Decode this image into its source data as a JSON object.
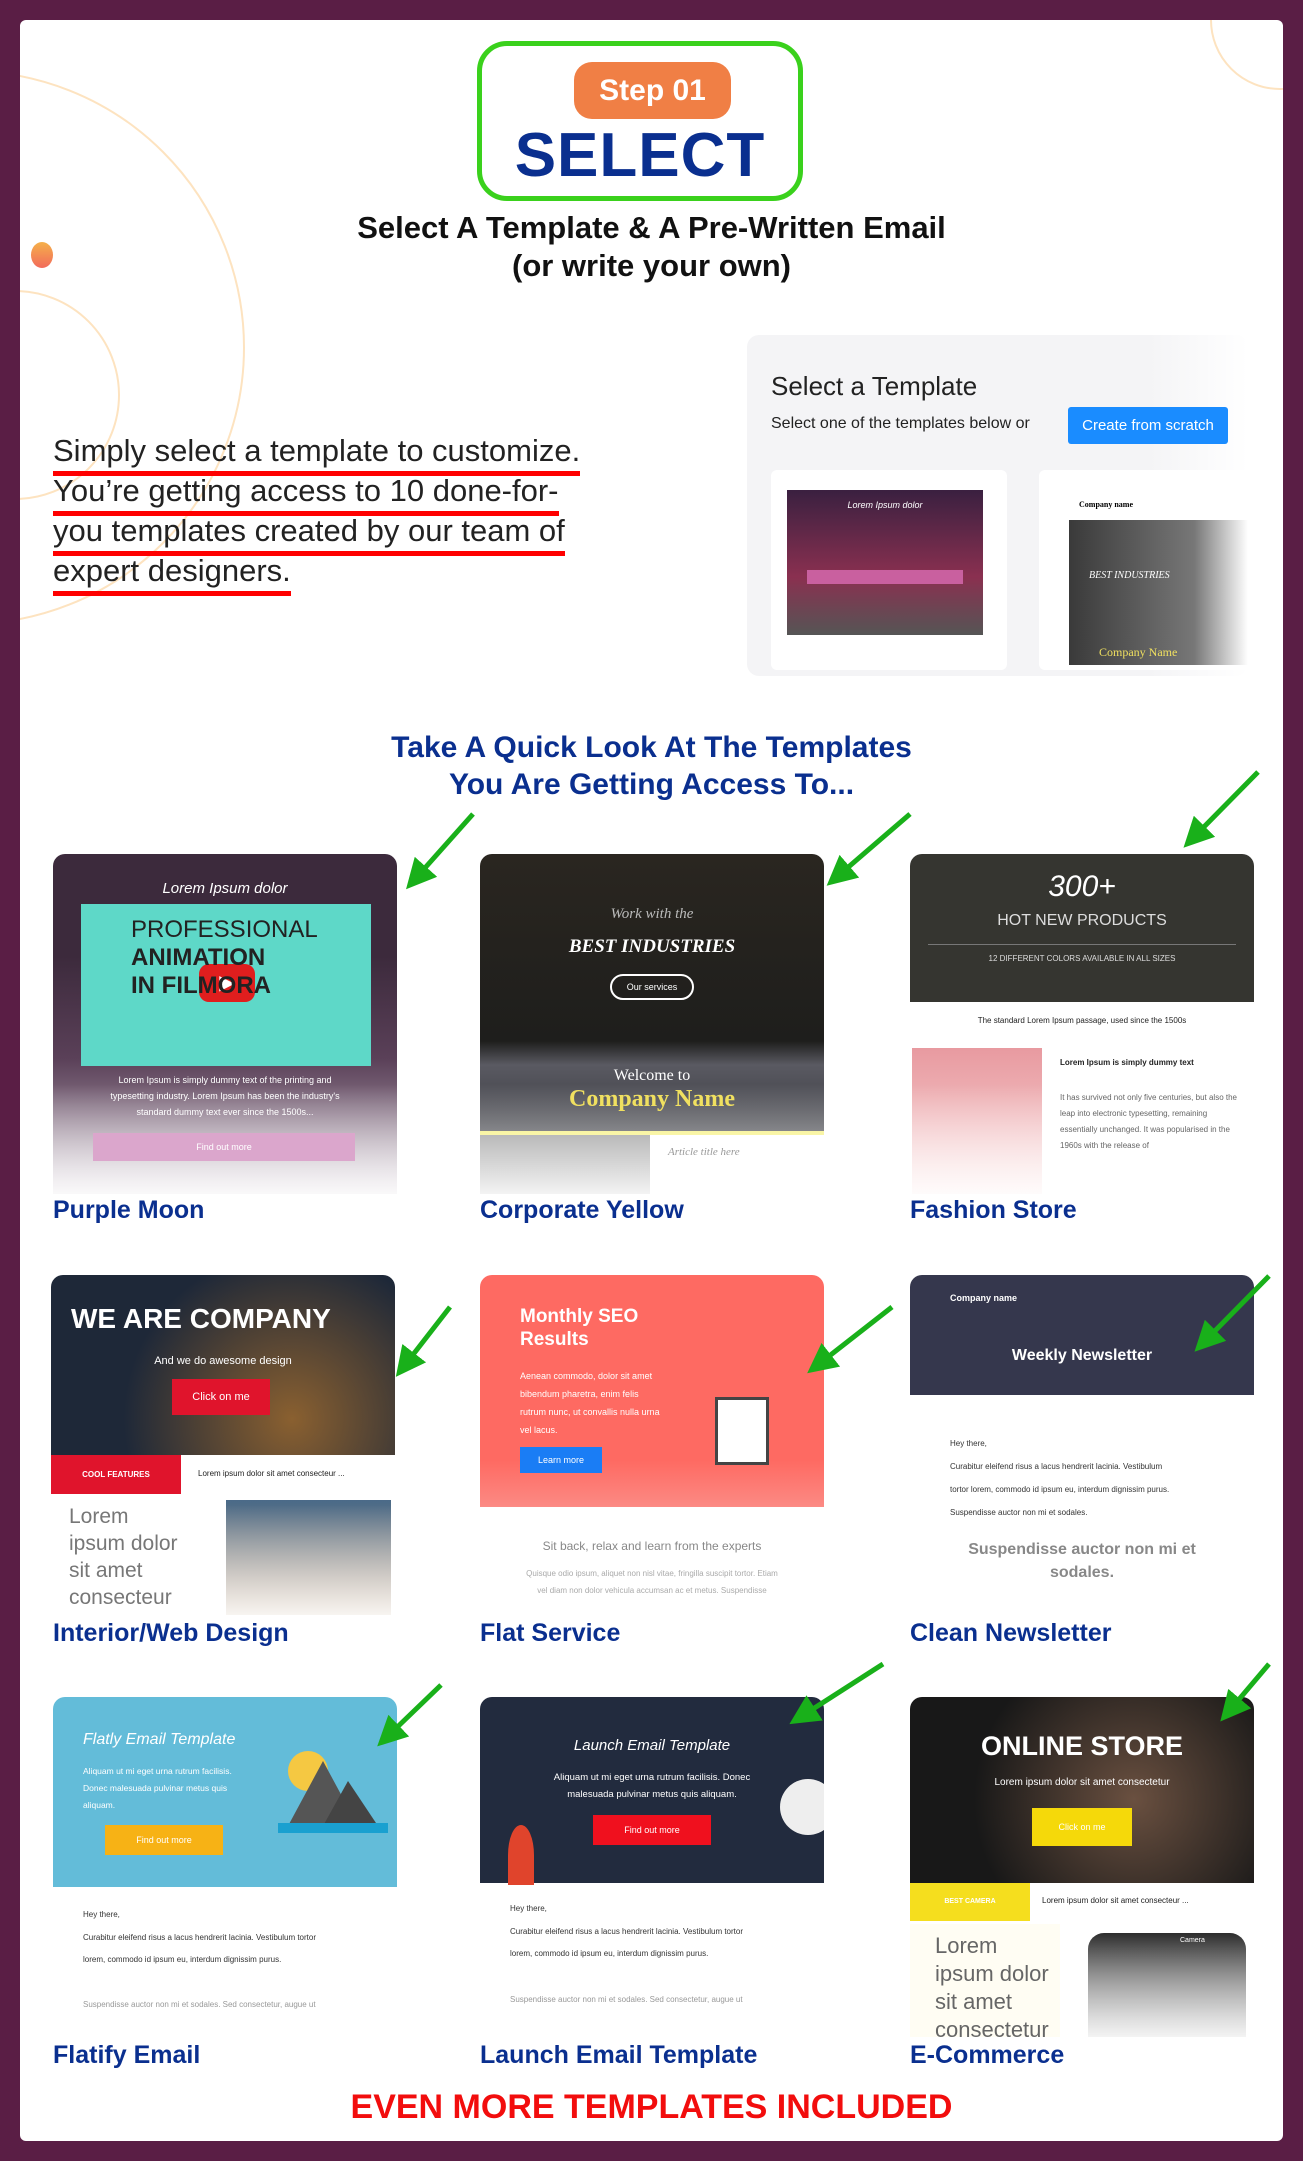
{
  "step": {
    "badge": "Step 01",
    "title": "SELECT"
  },
  "subtitle": {
    "line1": "Select A Template & A Pre-Written Email",
    "line2": "(or write your own)"
  },
  "intro": {
    "lines": [
      "Simply select a template to customize.",
      "You’re getting access to 10 done-for-",
      "you templates created by our team of",
      "expert designers."
    ]
  },
  "mockup": {
    "title": "Select a Template",
    "subtitle": "Select one of the templates below or",
    "button": "Create from scratch",
    "thumb1_title": "Lorem Ipsum dolor",
    "thumb2_title": "Company name",
    "thumb2_sub": "BEST INDUSTRIES",
    "thumb2_foot": "Company Name"
  },
  "section": {
    "line1": "Take A Quick Look At The Templates",
    "line2": "You Are Getting Access To..."
  },
  "colors": {
    "brand_blue": "#0a2f8f",
    "accent_red": "#f20d0d",
    "arrow_green": "#19b01a",
    "step_orange": "#f07f45",
    "frame_green": "#3ad11c",
    "border_purple": "#5a1e45"
  },
  "templates": [
    {
      "name": "Purple Moon",
      "heading": "Lorem Ipsum dolor",
      "video1": "PROFESSIONAL",
      "video2": "ANIMATION",
      "video3": "IN FILMORA",
      "body": "Lorem Ipsum is simply dummy text of the printing and typesetting industry. Lorem Ipsum has been the industry's standard dummy text ever since the 1500s...",
      "button": "Find out more"
    },
    {
      "name": "Corporate Yellow",
      "pre": "Work with the",
      "heading": "BEST INDUSTRIES",
      "button": "Our services",
      "welcome": "Welcome to",
      "company": "Company Name",
      "article": "Article title here"
    },
    {
      "name": "Fashion Store",
      "big": "300+",
      "heading": "HOT NEW PRODUCTS",
      "sub": "12 DIFFERENT COLORS AVAILABLE IN ALL SIZES",
      "passage": "The standard Lorem Ipsum passage, used since the 1500s",
      "item": "Lorem Ipsum is simply dummy text",
      "body": "It has survived not only five centuries, but also the leap into electronic typesetting, remaining essentially unchanged. It was popularised in the 1960s with the release of"
    },
    {
      "name": "Interior/Web Design",
      "heading": "WE ARE COMPANY",
      "sub": "And we do awesome design",
      "button": "Click on me",
      "tag": "COOL FEATURES",
      "tagtext": "Lorem ipsum dolor sit amet consecteur ...",
      "big": "Lorem ipsum dolor sit amet consecteur"
    },
    {
      "name": "Flat Service",
      "heading": "Monthly SEO Results",
      "body": "Aenean commodo, dolor sit amet bibendum pharetra, enim felis rutrum nunc, ut convallis nulla urna vel lacus.",
      "button": "Learn more",
      "tagline": "Sit back, relax and learn from the experts",
      "small": "Quisque odio ipsum, aliquet non nisl vitae, fringilla suscipit tortor. Etiam vel diam non dolor vehicula accumsan ac et metus. Suspendisse"
    },
    {
      "name": "Clean Newsletter",
      "company": "Company name",
      "heading": "Weekly Newsletter",
      "greet": "Hey there,",
      "body1": "Curabitur eleifend risus a lacus hendrerit lacinia. Vestibulum",
      "body2": "tortor lorem, commodo id ipsum eu, interdum dignissim purus.",
      "body3": "Suspendisse auctor non mi et sodales.",
      "quote": "Suspendisse auctor non mi et sodales."
    },
    {
      "name": "Flatify Email",
      "heading": "Flatly Email Template",
      "body": "Aliquam ut mi eget urna rutrum facilisis. Donec malesuada pulvinar metus quis aliquam.",
      "button": "Find out more",
      "greet": "Hey there,",
      "text1": "Curabitur eleifend risus a lacus hendrerit lacinia. Vestibulum tortor",
      "text2": "lorem, commodo id ipsum eu, interdum dignissim purus.",
      "text3": "Suspendisse auctor non mi et sodales. Sed consectetur, augue ut"
    },
    {
      "name": "Launch Email Template",
      "heading": "Launch Email Template",
      "body": "Aliquam ut mi eget urna rutrum facilisis. Donec malesuada pulvinar metus quis aliquam.",
      "button": "Find out more",
      "greet": "Hey there,",
      "text1": "Curabitur eleifend risus a lacus hendrerit lacinia. Vestibulum tortor",
      "text2": "lorem, commodo id ipsum eu, interdum dignissim purus.",
      "text3": "Suspendisse auctor non mi et sodales. Sed consectetur, augue ut"
    },
    {
      "name": "E-Commerce",
      "heading": "ONLINE STORE",
      "sub": "Lorem ipsum dolor sit amet consectetur",
      "button": "Click on me",
      "tag": "BEST CAMERA",
      "tagtext": "Lorem ipsum dolor sit amet consecteur ...",
      "big": "Lorem ipsum dolor sit amet consectetur",
      "camera": "Camera"
    }
  ],
  "footer": {
    "more": "EVEN MORE TEMPLATES INCLUDED"
  }
}
